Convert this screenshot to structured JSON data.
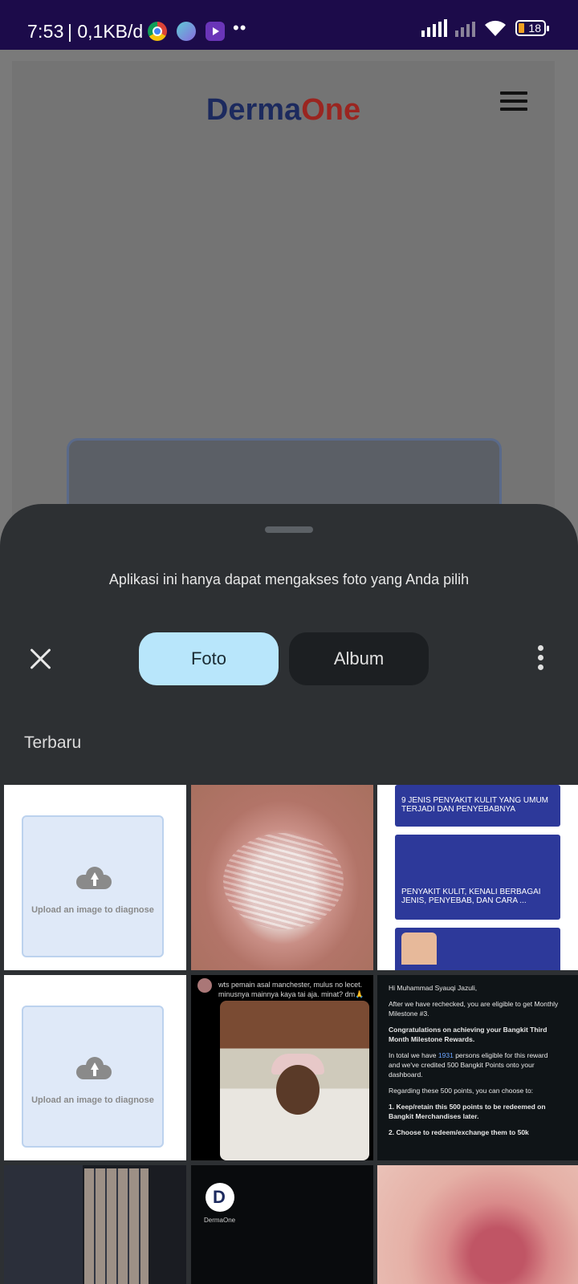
{
  "status_bar": {
    "time": "7:53",
    "network_speed": "| 0,1KB/d",
    "app_icons": [
      "chrome-icon",
      "app-icon",
      "media-icon"
    ],
    "overflow": "••",
    "battery": "18"
  },
  "webpage": {
    "logo_part1": "Derma",
    "logo_part2": "One",
    "logo_colors": {
      "part1": "#1c2a5e",
      "part2": "#9a2520"
    }
  },
  "sheet": {
    "message": "Aplikasi ini hanya dapat mengakses foto yang Anda pilih",
    "tabs": [
      {
        "label": "Foto",
        "selected": true
      },
      {
        "label": "Album",
        "selected": false
      }
    ],
    "section_label": "Terbaru"
  },
  "grid": {
    "upload_text": "Upload an image to diagnose",
    "article": {
      "item1": "9 JENIS PENYAKIT KULIT YANG UMUM TERJADI DAN PENYEBABNYA",
      "item2": "PENYAKIT KULIT, KENALI BERBAGAI JENIS, PENYEBAB, DAN CARA ..."
    },
    "tweet": {
      "handle": "wts pemain asal manchester, mulus no lecet. minusnya mainnya kaya tai aja. minat? dm🙏"
    },
    "email": {
      "greeting": "Hi Muhammad Syauqi Jazuli,",
      "line1": "After we have rechecked, you are eligible to get Monthly Milestone #3.",
      "line2": "Congratulations on achieving your Bangkit Third Month Milestone Rewards.",
      "line3_a": "In total we have ",
      "line3_num": "1931",
      "line3_b": " persons eligible for this reward and we've credited 500 Bangkit Points onto your dashboard.",
      "line4": "Regarding these 500 points, you can choose to:",
      "opt1": "1.   Keep/retain this 500 points to be redeemed on Bangkit Merchandises later.",
      "opt2": "2.   Choose to redeem/exchange them to 50k"
    },
    "dark_thumb_label": "DermaOne"
  }
}
